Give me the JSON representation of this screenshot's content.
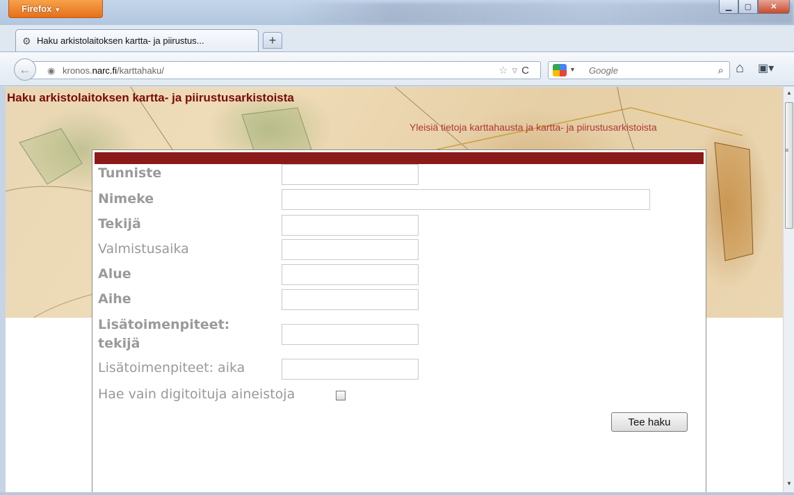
{
  "browser": {
    "menu_button": "Firefox",
    "tab_title": "Haku arkistolaitoksen kartta- ja piirustus...",
    "url_prefix": "kronos.",
    "url_domain": "narc.fi",
    "url_path": "/karttahaku/",
    "search_engine_placeholder": "Google"
  },
  "page": {
    "title": "Haku arkistolaitoksen kartta- ja piirustusarkistoista",
    "info_link": "Yleisiä tietoja karttahausta ja kartta- ja piirustusarkistoista"
  },
  "form": {
    "fields": [
      {
        "label": "Tunniste",
        "value": ""
      },
      {
        "label": "Nimeke",
        "value": ""
      },
      {
        "label": "Tekijä",
        "value": ""
      },
      {
        "label": "Valmistusaika",
        "value": ""
      },
      {
        "label": "Alue",
        "value": ""
      },
      {
        "label": "Aihe",
        "value": ""
      },
      {
        "label_line1": "Lisätoimenpiteet:",
        "label_line2": "tekijä",
        "value": ""
      },
      {
        "label": "Lisätoimenpiteet: aika",
        "value": ""
      }
    ],
    "digitized_only_label": "Hae vain digitoituja aineistoja",
    "digitized_only_checked": false,
    "submit_label": "Tee haku"
  },
  "colors": {
    "title": "#7a0a0a",
    "link": "#b2353a",
    "form_header_bar": "#8b1a1a"
  }
}
